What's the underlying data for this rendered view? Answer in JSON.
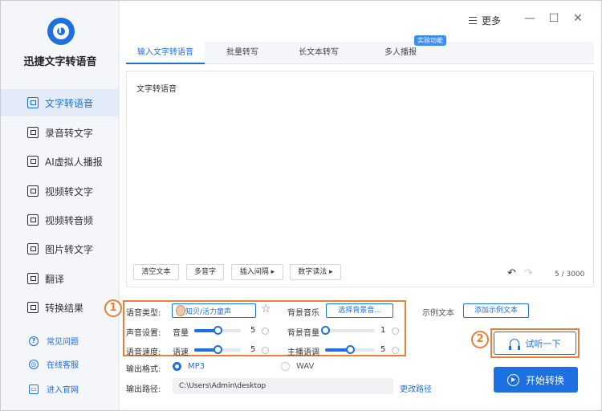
{
  "app": {
    "title": "迅捷文字转语音"
  },
  "sidebar": {
    "items": [
      {
        "label": "文字转语音",
        "active": true
      },
      {
        "label": "录音转文字"
      },
      {
        "label": "AI虚拟人播报"
      },
      {
        "label": "视频转文字"
      },
      {
        "label": "视频转音频"
      },
      {
        "label": "图片转文字"
      },
      {
        "label": "翻译"
      },
      {
        "label": "转换结果"
      }
    ],
    "links": [
      {
        "label": "常见问题",
        "icon": "?"
      },
      {
        "label": "在线客服",
        "icon": "◎"
      },
      {
        "label": "进入官网",
        "icon": "▭"
      }
    ]
  },
  "topbar": {
    "more_label": "更多",
    "minimize": "—",
    "maximize": "☐",
    "close": "✕"
  },
  "tabs": [
    {
      "label": "输入文字转语音",
      "active": true
    },
    {
      "label": "批量转写"
    },
    {
      "label": "长文本转写"
    },
    {
      "label": "多人播报"
    }
  ],
  "badge": {
    "label": "实验功能"
  },
  "editor": {
    "text": "文字转语音",
    "tools": [
      "清空文本",
      "多音字",
      "插入间隔 ▸",
      "数字读法 ▸"
    ],
    "undo_icon": "↶",
    "redo_icon": "↷",
    "count": "5 / 3000"
  },
  "settings": {
    "voice_type_label": "语音类型:",
    "voice_name": "知贝/活力童声",
    "favorite_icon": "☆",
    "sound_setting_label": "声音设置:",
    "speed_label": "语音速度:",
    "volume_label": "音量",
    "volume_value": "5",
    "volume_fraction": 0.5,
    "rate_label": "语速",
    "rate_value": "5",
    "rate_fraction": 0.5,
    "bgm_label": "背景音乐",
    "bgm_button": "选择背景音...",
    "bgm_volume_label": "背景音量",
    "bgm_volume_value": "1",
    "bgm_volume_fraction": 0.0,
    "pitch_label": "主播语调",
    "pitch_value": "5",
    "pitch_fraction": 0.5,
    "sample_label": "示例文本",
    "sample_button": "添加示例文本"
  },
  "annotations": {
    "one": "1",
    "two": "2"
  },
  "output": {
    "format_label": "输出格式:",
    "formats": [
      {
        "label": "MP3",
        "selected": true
      },
      {
        "label": "WAV",
        "selected": false
      }
    ],
    "path_label": "输出路径:",
    "path_value": "C:\\Users\\Admin\\desktop",
    "change_path": "更改路径"
  },
  "actions": {
    "listen": "试听一下",
    "start": "开始转换"
  },
  "colors": {
    "accent": "#1e6fe0",
    "annotation": "#e8803a"
  }
}
